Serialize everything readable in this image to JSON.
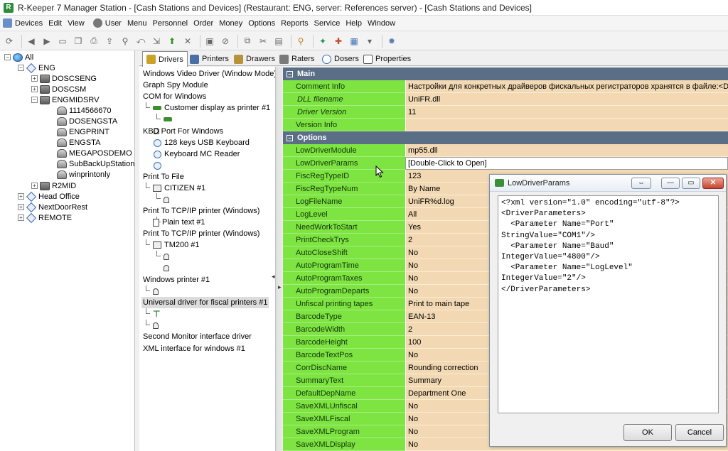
{
  "window": {
    "title": "R-Keeper 7 Manager Station - [Cash Stations and Devices] (Restaurant: ENG, server: References server) - [Cash Stations and Devices]"
  },
  "menu": [
    "Devices",
    "Edit",
    "View",
    "User",
    "Menu",
    "Personnel",
    "Order",
    "Money",
    "Options",
    "Reports",
    "Service",
    "Help",
    "Window"
  ],
  "tree": {
    "all": "All",
    "eng": "ENG",
    "items": [
      "DOSCSENG",
      "DOSCSM",
      "ENGMIDSRV",
      "1114566670",
      "DOSENGSTA",
      "ENGPRINT",
      "ENGSTA",
      "MEGAPOSDEMO",
      "SubBackUpStation",
      "winprintonly",
      "R2MID",
      "Head Office",
      "NextDoorRest",
      "REMOTE"
    ]
  },
  "tabs": [
    "Drivers",
    "Printers",
    "Drawers",
    "Raters",
    "Dosers",
    "Properties"
  ],
  "drivers": {
    "items": [
      "Windows Video Driver (Window Mode)",
      "Graph Spy Module",
      "COM for Windows",
      "Customer display as printer #1",
      "KBD Port For Windows",
      "128 keys USB Keyboard",
      "Keyboard MC Reader",
      "Print To File",
      "CITIZEN #1",
      "Print To TCP/IP printer (Windows)",
      "Plain text #1",
      "Print To TCP/IP printer (Windows)",
      "TM200 #1",
      "Windows printer #1",
      "Universal driver for fiscal printers #1",
      "Second Monitor interface driver",
      "XML interface for windows #1"
    ]
  },
  "props": {
    "main_label": "Main",
    "options_label": "Options",
    "main_rows": [
      {
        "name": "Comment Info",
        "value": "Настройки для конкретных драйверов фискальных регистраторов хранятся в файле:<DRIVE"
      },
      {
        "name": "DLL filename",
        "value": "UniFR.dll"
      },
      {
        "name": "Driver Version",
        "value": "11"
      },
      {
        "name": "Version Info",
        "value": ""
      }
    ],
    "option_rows": [
      {
        "name": "LowDriverModule",
        "value": "mp55.dll"
      },
      {
        "name": "LowDriverParams",
        "value": "[Double-Click to Open]"
      },
      {
        "name": "FiscRegTypeID",
        "value": "123"
      },
      {
        "name": "FiscRegTypeNum",
        "value": "By Name"
      },
      {
        "name": "LogFileName",
        "value": "UniFR%d.log"
      },
      {
        "name": "LogLevel",
        "value": "All"
      },
      {
        "name": "NeedWorkToStart",
        "value": "Yes"
      },
      {
        "name": "PrintCheckTrys",
        "value": "2"
      },
      {
        "name": "AutoCloseShift",
        "value": "No"
      },
      {
        "name": "AutoProgramTime",
        "value": "No"
      },
      {
        "name": "AutoProgramTaxes",
        "value": "No"
      },
      {
        "name": "AutoProgramDeparts",
        "value": "No"
      },
      {
        "name": "Unfiscal printing tapes",
        "value": "Print to main tape"
      },
      {
        "name": "BarcodeType",
        "value": "EAN-13"
      },
      {
        "name": "BarcodeWidth",
        "value": "2"
      },
      {
        "name": "BarcodeHeight",
        "value": "100"
      },
      {
        "name": "BarcodeTextPos",
        "value": "No"
      },
      {
        "name": "CorrDiscName",
        "value": "Rounding correction"
      },
      {
        "name": "SummaryText",
        "value": "Summary"
      },
      {
        "name": "DefaultDepName",
        "value": "Department One"
      },
      {
        "name": "SaveXMLUnfiscal",
        "value": "No"
      },
      {
        "name": "SaveXMLFiscal",
        "value": "No"
      },
      {
        "name": "SaveXMLProgram",
        "value": "No"
      },
      {
        "name": "SaveXMLDisplay",
        "value": "No"
      }
    ]
  },
  "dialog": {
    "title": "LowDriverParams",
    "text": "<?xml version=\"1.0\" encoding=\"utf-8\"?>\n<DriverParameters>\n  <Parameter Name=\"Port\"\nStringValue=\"COM1\"/>\n  <Parameter Name=\"Baud\"\nIntegerValue=\"4800\"/>\n  <Parameter Name=\"LogLevel\"\nIntegerValue=\"2\"/>\n</DriverParameters>",
    "ok": "OK",
    "cancel": "Cancel"
  }
}
